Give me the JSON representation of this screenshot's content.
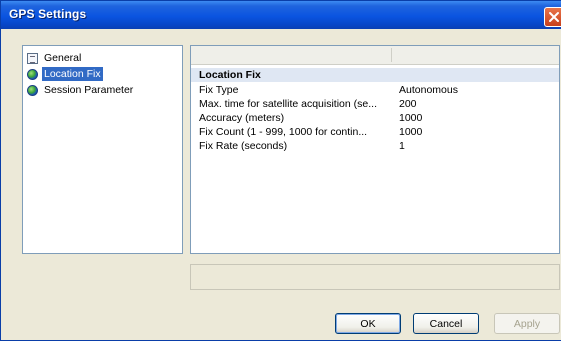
{
  "window": {
    "title": "GPS Settings"
  },
  "tree": {
    "items": [
      {
        "label": "General",
        "icon": "page-icon",
        "selected": false
      },
      {
        "label": "Location Fix",
        "icon": "globe-icon",
        "selected": true
      },
      {
        "label": "Session Parameter",
        "icon": "globe-icon",
        "selected": false
      }
    ]
  },
  "property_grid": {
    "category": "Location Fix",
    "rows": [
      {
        "name": "Fix Type",
        "value": "Autonomous"
      },
      {
        "name": "Max. time for satellite acquisition (se...",
        "value": "200"
      },
      {
        "name": "Accuracy (meters)",
        "value": "1000"
      },
      {
        "name": "Fix Count (1 - 999, 1000 for contin...",
        "value": "1000"
      },
      {
        "name": "Fix Rate (seconds)",
        "value": "1"
      }
    ]
  },
  "buttons": {
    "ok": "OK",
    "cancel": "Cancel",
    "apply": "Apply"
  },
  "colors": {
    "titlebar": "#0a54e0",
    "selection": "#316ac5",
    "dialog_bg": "#ece9d8"
  }
}
